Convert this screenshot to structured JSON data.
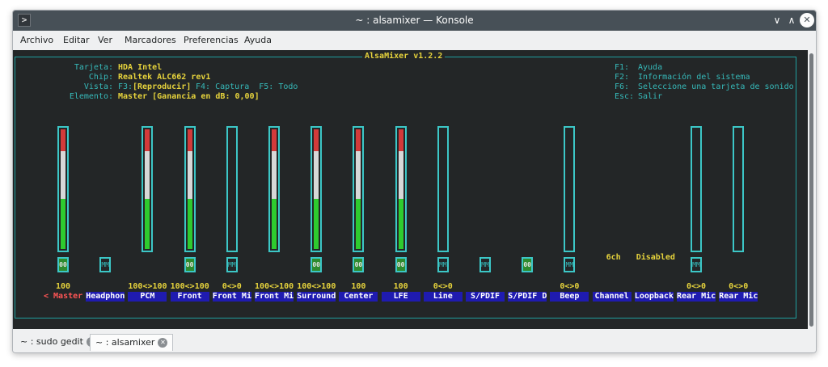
{
  "window": {
    "title": "~ : alsamixer — Konsole",
    "app_icon_glyph": ">",
    "buttons": {
      "minimize": "∨",
      "maximize": "∧",
      "close": "✕"
    }
  },
  "menu": [
    "Archivo",
    "Editar",
    "Ver",
    "Marcadores",
    "Preferencias",
    "Ayuda"
  ],
  "mixer": {
    "title": "AlsaMixer v1.2.2",
    "info": {
      "card_label": "Tarjeta:",
      "card": "HDA Intel",
      "chip_label": "Chip:",
      "chip": "Realtek ALC662 rev1",
      "view_label": "Vista:",
      "view_f3": "F3:",
      "view_play": "[Reproducir]",
      "view_rest": "F4: Captura  F5: Todo",
      "elem_label": "Elemento:",
      "elem": "Master [Ganancia en dB: 0,00]"
    },
    "help": [
      {
        "key": "F1:",
        "text": "Ayuda"
      },
      {
        "key": "F2:",
        "text": "Información del sistema"
      },
      {
        "key": "F6:",
        "text": "Seleccione una tarjeta de sonido"
      },
      {
        "key": "Esc:",
        "text": "Salir"
      }
    ],
    "channels": [
      {
        "label": "< Master >",
        "volume": "100",
        "switch": "00",
        "level": 100,
        "selected": true
      },
      {
        "label": "Headphon",
        "volume": "",
        "switch": "MM",
        "level": null
      },
      {
        "label": "PCM",
        "volume": "100<>100",
        "switch": "",
        "level": 100
      },
      {
        "label": "Front",
        "volume": "100<>100",
        "switch": "00",
        "level": 100
      },
      {
        "label": "Front Mi",
        "volume": "0<>0",
        "switch": "MM",
        "level": 0
      },
      {
        "label": "Front Mi",
        "volume": "100<>100",
        "switch": "",
        "level": 100
      },
      {
        "label": "Surround",
        "volume": "100<>100",
        "switch": "00",
        "level": 100
      },
      {
        "label": "Center",
        "volume": "100",
        "switch": "00",
        "level": 100
      },
      {
        "label": "LFE",
        "volume": "100",
        "switch": "00",
        "level": 100
      },
      {
        "label": "Line",
        "volume": "0<>0",
        "switch": "MM",
        "level": 0
      },
      {
        "label": "S/PDIF",
        "volume": "",
        "switch": "MM",
        "level": null
      },
      {
        "label": "S/PDIF D",
        "volume": "",
        "switch": "00",
        "level": null
      },
      {
        "label": "Beep",
        "volume": "0<>0",
        "switch": "MM",
        "level": 0
      },
      {
        "label": "Channel",
        "volume": "",
        "switch": "",
        "level": null,
        "enum": "6ch"
      },
      {
        "label": "Loopback",
        "volume": "",
        "switch": "",
        "level": null,
        "enum": "Disabled"
      },
      {
        "label": "Rear Mic",
        "volume": "0<>0",
        "switch": "MM",
        "level": 0
      },
      {
        "label": "Rear Mic",
        "volume": "0<>0",
        "switch": "",
        "level": 0
      }
    ]
  },
  "tabs": [
    {
      "label": "~ : sudo gedit",
      "active": false
    },
    {
      "label": "~ : alsamixer",
      "active": true
    }
  ],
  "colors": {
    "terminal_bg": "#232627",
    "cyan": "#36b9b9",
    "yellow": "#e6d33c",
    "red": "#d33a3a",
    "white": "#d8d8d8",
    "green": "#2ecc2e",
    "label_bg": "#1f1bb0"
  }
}
